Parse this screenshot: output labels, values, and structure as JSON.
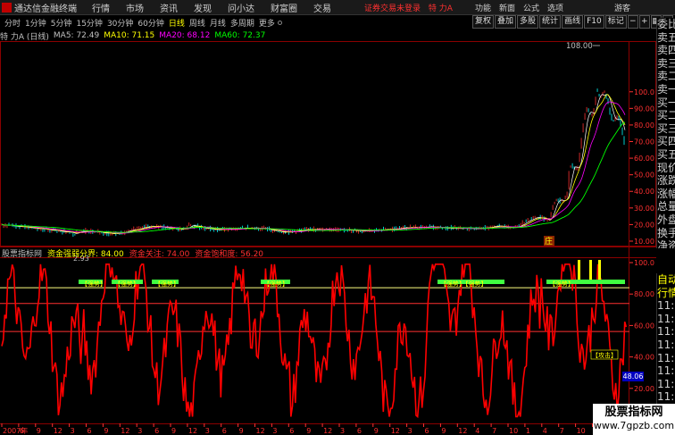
{
  "menubar": {
    "app_title": "通达信金融终端",
    "items": [
      "行情",
      "市场",
      "资讯",
      "发现",
      "问小达",
      "财富圈",
      "交易"
    ],
    "notice": "证券交易未登录",
    "stock": "特 力A",
    "right_items": [
      "功能",
      "新面",
      "公式",
      "选项"
    ],
    "guest": "游客"
  },
  "toolbar": {
    "periods": [
      "分时",
      "1分钟",
      "5分钟",
      "15分钟",
      "30分钟",
      "60分钟",
      "日线",
      "周线",
      "月线",
      "多周期",
      "更多"
    ],
    "active": "日线"
  },
  "right_buttons": [
    "复权",
    "叠加",
    "多股",
    "统计",
    "画线",
    "F10",
    "标记"
  ],
  "info": {
    "title": "特 力A (日线)",
    "ma5": "MA5: 72.49",
    "ma10": "MA10: 71.15",
    "ma20": "MA20: 68.12",
    "ma60": "MA60: 72.37"
  },
  "price_axis": [
    "100.0",
    "90.00",
    "80.00",
    "70.00",
    "60.00",
    "50.00",
    "40.00",
    "30.00",
    "20.00",
    "10.00"
  ],
  "price_high_label": "108.00",
  "price_low_label": "2.93",
  "tag_label": "庄",
  "indicator": {
    "site": "股票指标网",
    "line1": "资金强弱分界: 84.00",
    "line2": "资金关注: 74.00",
    "line3": "资金饱和度: 56.20",
    "axis": [
      "100.0",
      "80.00",
      "60.00",
      "40.00",
      "20.00"
    ],
    "current": "48.06",
    "attack_label": "【攻击】",
    "signal_labels": [
      "【强势】",
      "【强势】",
      "【强势】",
      "【强势】",
      "【强势】【强势】",
      "【强势】"
    ]
  },
  "x_axis": [
    "2007年",
    "6",
    "9",
    "12",
    "3",
    "6",
    "9",
    "12",
    "3",
    "6",
    "9",
    "12",
    "3",
    "6",
    "9",
    "12",
    "3",
    "6",
    "9",
    "12",
    "3",
    "6",
    "9",
    "12",
    "3",
    "6",
    "9",
    "12",
    "4",
    "7",
    "10",
    "1",
    "4",
    "7",
    "10",
    "1",
    "4"
  ],
  "sidebar": {
    "top_left": "L",
    "top_right": "◀◀",
    "items": [
      "委比",
      "卖五",
      "卖四",
      "卖三",
      "卖二",
      "卖一",
      "买一",
      "买二",
      "买三",
      "买四",
      "买五",
      "现价",
      "涨跌",
      "涨幅",
      "总量",
      "外盘",
      "换手",
      "净资",
      "收益"
    ],
    "items2": [
      "自动",
      "行情",
      "11:1",
      "11:1",
      "11:1",
      "11:1",
      "11:1",
      "11:1",
      "11:1",
      "11:1",
      "11:1",
      "11:1",
      "11:1"
    ]
  },
  "watermark": {
    "line1": "股票指标网",
    "line2": "www.7gpzb.com"
  },
  "colors": {
    "red": "#ff0000",
    "ma_green": "#00ff00",
    "ma_purple": "#ff00ff",
    "ma_yellow": "#ffff00",
    "grid": "#8b0000"
  }
}
